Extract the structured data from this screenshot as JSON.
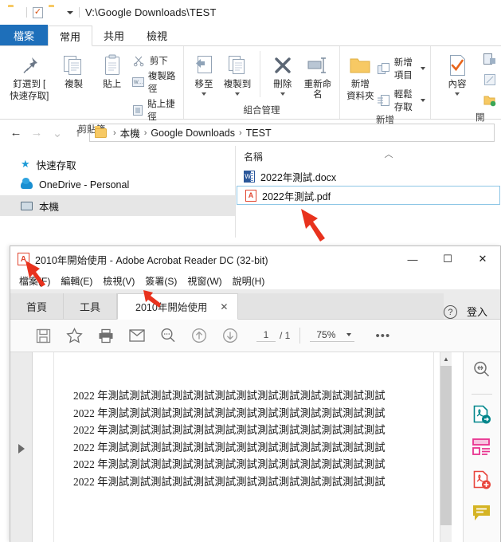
{
  "explorer": {
    "title_path": "V:\\Google Downloads\\TEST",
    "quick_access": {
      "folder": "folder-icon",
      "properties": "properties-icon",
      "newfolder": "new-folder-icon"
    },
    "tabs": [
      {
        "label": "檔案",
        "name": "tab-file"
      },
      {
        "label": "常用",
        "name": "tab-home"
      },
      {
        "label": "共用",
        "name": "tab-share"
      },
      {
        "label": "檢視",
        "name": "tab-view"
      }
    ],
    "ribbon": {
      "clipboard": {
        "label": "剪貼簿",
        "pin": "釘選到 [\n快速存取]",
        "pin_line1": "釘選到 [",
        "pin_line2": "快速存取]",
        "copy": "複製",
        "paste": "貼上",
        "cut": "剪下",
        "copy_path": "複製路徑",
        "paste_shortcut": "貼上捷徑"
      },
      "organize": {
        "label": "組合管理",
        "move_to": "移至",
        "copy_to": "複製到",
        "delete": "刪除",
        "rename": "重新命名"
      },
      "new": {
        "label": "新增",
        "new_folder_line1": "新增",
        "new_folder_line2": "資料夾",
        "new_item": "新增項目",
        "easy_access": "輕鬆存取"
      },
      "open": {
        "label": "開",
        "properties": "內容"
      }
    },
    "address": {
      "back": "←",
      "forward": "→",
      "recent": "⌄",
      "up": "↑",
      "crumbs": [
        "本機",
        "Google Downloads",
        "TEST"
      ]
    },
    "sidebar": [
      {
        "label": "快速存取",
        "icon": "star-icon",
        "selected": false
      },
      {
        "label": "OneDrive - Personal",
        "icon": "cloud-icon",
        "selected": false
      },
      {
        "label": "本機",
        "icon": "this-pc-icon",
        "selected": true
      }
    ],
    "files": {
      "column_name": "名稱",
      "sort_indicator": "︿",
      "rows": [
        {
          "name": "2022年測試.docx",
          "icon": "word-icon",
          "selected": false
        },
        {
          "name": "2022年測試.pdf",
          "icon": "pdf-icon",
          "selected": true
        }
      ]
    }
  },
  "acrobat": {
    "window_title": "2010年開始使用 - Adobe Acrobat Reader DC (32-bit)",
    "window_buttons": {
      "minimize": "—",
      "maximize": "☐",
      "close": "✕"
    },
    "menu": [
      "檔案(F)",
      "編輯(E)",
      "檢視(V)",
      "簽署(S)",
      "視窗(W)",
      "說明(H)"
    ],
    "tabs": {
      "home": "首頁",
      "tools": "工具",
      "document": "2010年開始使用",
      "close_glyph": "✕",
      "help_glyph": "?",
      "signin": "登入"
    },
    "toolbar": {
      "page_current": "1",
      "page_total": "/ 1",
      "zoom": "75%",
      "more": "•••",
      "icons": [
        "save-icon",
        "star-icon",
        "print-icon",
        "email-icon",
        "search-icon",
        "previous-page-icon",
        "next-page-icon"
      ]
    },
    "right_tools": [
      {
        "name": "search-tool-icon"
      },
      {
        "name": "export-pdf-icon"
      },
      {
        "name": "edit-pdf-icon"
      },
      {
        "name": "create-pdf-icon"
      },
      {
        "name": "comment-icon"
      }
    ],
    "document": {
      "lines": [
        "2022 年測試測試測試測試測試測試測試測試測試測試測試測試測試",
        "2022 年測試測試測試測試測試測試測試測試測試測試測試測試測試",
        "2022 年測試測試測試測試測試測試測試測試測試測試測試測試測試",
        "2022 年測試測試測試測試測試測試測試測試測試測試測試測試測試",
        "2022 年測試測試測試測試測試測試測試測試測試測試測試測試測試",
        "2022 年測試測試測試測試測試測試測試測試測試測試測試測試測試"
      ]
    }
  },
  "annotations": {
    "color": "#e8321d",
    "arrows": [
      {
        "name": "arrow-pointing-pdf-file",
        "target": "2022年測試.pdf"
      },
      {
        "name": "arrow-pointing-window-title",
        "target": "2010年開始使用"
      },
      {
        "name": "arrow-pointing-document-tab",
        "target": "2010年開始使用"
      }
    ]
  }
}
